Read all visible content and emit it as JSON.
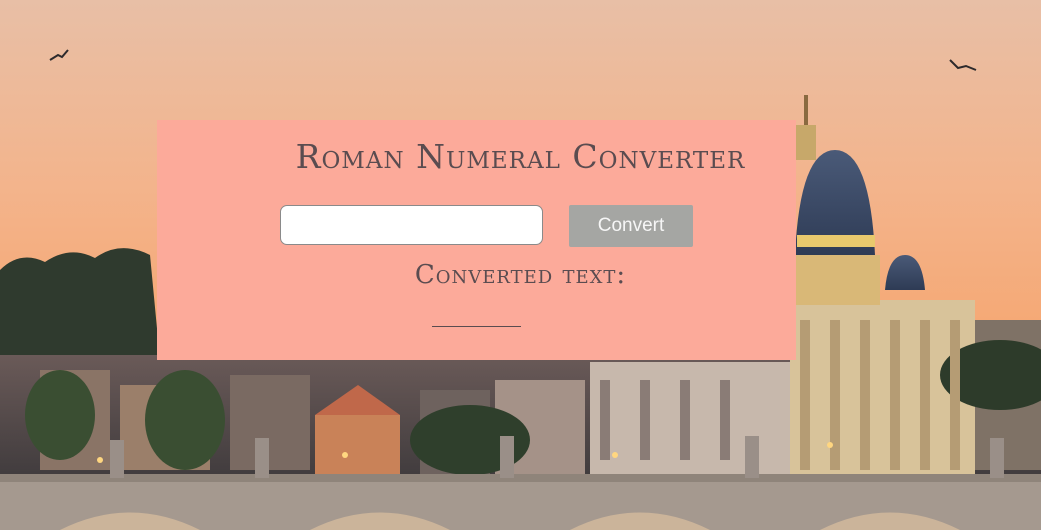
{
  "page": {
    "title": "Roman Numeral Converter"
  },
  "converter": {
    "input_value": "",
    "input_placeholder": "",
    "button_label": "Convert",
    "result_label": "Converted text:",
    "result_value": ""
  },
  "colors": {
    "panel": "#fcaa9a",
    "text": "#5a4c50",
    "button": "#a5a6a3",
    "button_text": "#f6f6f6"
  }
}
